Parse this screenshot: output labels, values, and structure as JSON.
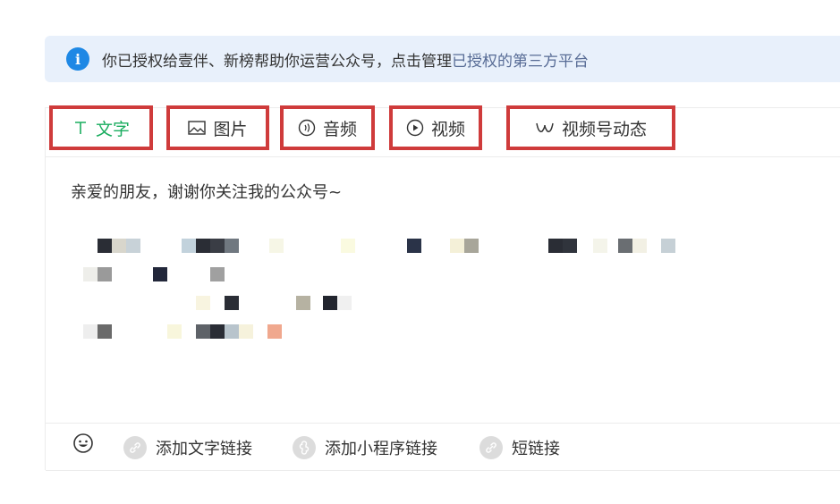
{
  "banner": {
    "icon": "info-icon",
    "text": "你已授权给壹伴、新榜帮助你运营公众号，点击管理",
    "link": "已授权的第三方平台"
  },
  "tabs": [
    {
      "id": "text",
      "label": "文字",
      "icon": "text-icon",
      "active": true
    },
    {
      "id": "image",
      "label": "图片",
      "icon": "image-icon",
      "active": false
    },
    {
      "id": "audio",
      "label": "音频",
      "icon": "audio-icon",
      "active": false
    },
    {
      "id": "video",
      "label": "视频",
      "icon": "video-icon",
      "active": false
    },
    {
      "id": "channel",
      "label": "视频号动态",
      "icon": "channel-icon",
      "active": false
    }
  ],
  "editor": {
    "content": "亲爱的朋友，谢谢你关注我的公众号~"
  },
  "footer": {
    "emoji_icon": "emoji-icon",
    "links": [
      {
        "label": "添加文字链接",
        "icon": "link-icon"
      },
      {
        "label": "添加小程序链接",
        "icon": "miniprogram-icon"
      },
      {
        "label": "短链接",
        "icon": "link-icon"
      }
    ]
  },
  "colors": {
    "accent": "#1aad5f",
    "highlight_border": "#cf3b3b",
    "info_blue": "#1e88e5",
    "banner_bg": "#e8f0fb",
    "link": "#576b95"
  }
}
